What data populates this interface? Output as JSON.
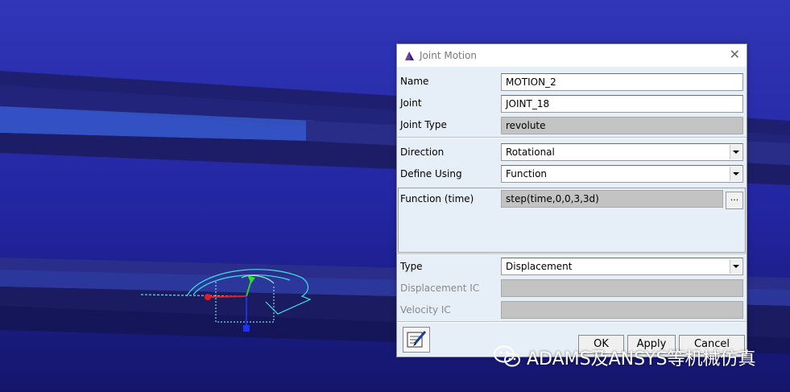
{
  "dialog": {
    "title": "Joint Motion",
    "close_symbol": "✕",
    "name_label": "Name",
    "name_value": "MOTION_2",
    "joint_label": "Joint",
    "joint_value": "JOINT_18",
    "joint_type_label": "Joint Type",
    "joint_type_value": "revolute",
    "direction_label": "Direction",
    "direction_value": "Rotational",
    "define_using_label": "Define Using",
    "define_using_value": "Function",
    "function_label": "Function (time)",
    "function_value": "step(time,0,0,3,3d)",
    "function_browse_label": "...",
    "type_label": "Type",
    "type_value": "Displacement",
    "displacement_ic_label": "Displacement IC",
    "displacement_ic_value": "",
    "velocity_ic_label": "Velocity IC",
    "velocity_ic_value": "",
    "ok_label": "OK",
    "apply_label": "Apply",
    "cancel_label": "Cancel"
  },
  "watermark": {
    "text": "ADAMS及ANSYS等机械仿真",
    "icon": "wechat-icon"
  },
  "colors": {
    "viewport_top": "#2f35b4",
    "viewport_bottom": "#15166a",
    "dialog_bg": "#e6eef8",
    "wireframe": "#3fe0e8"
  }
}
